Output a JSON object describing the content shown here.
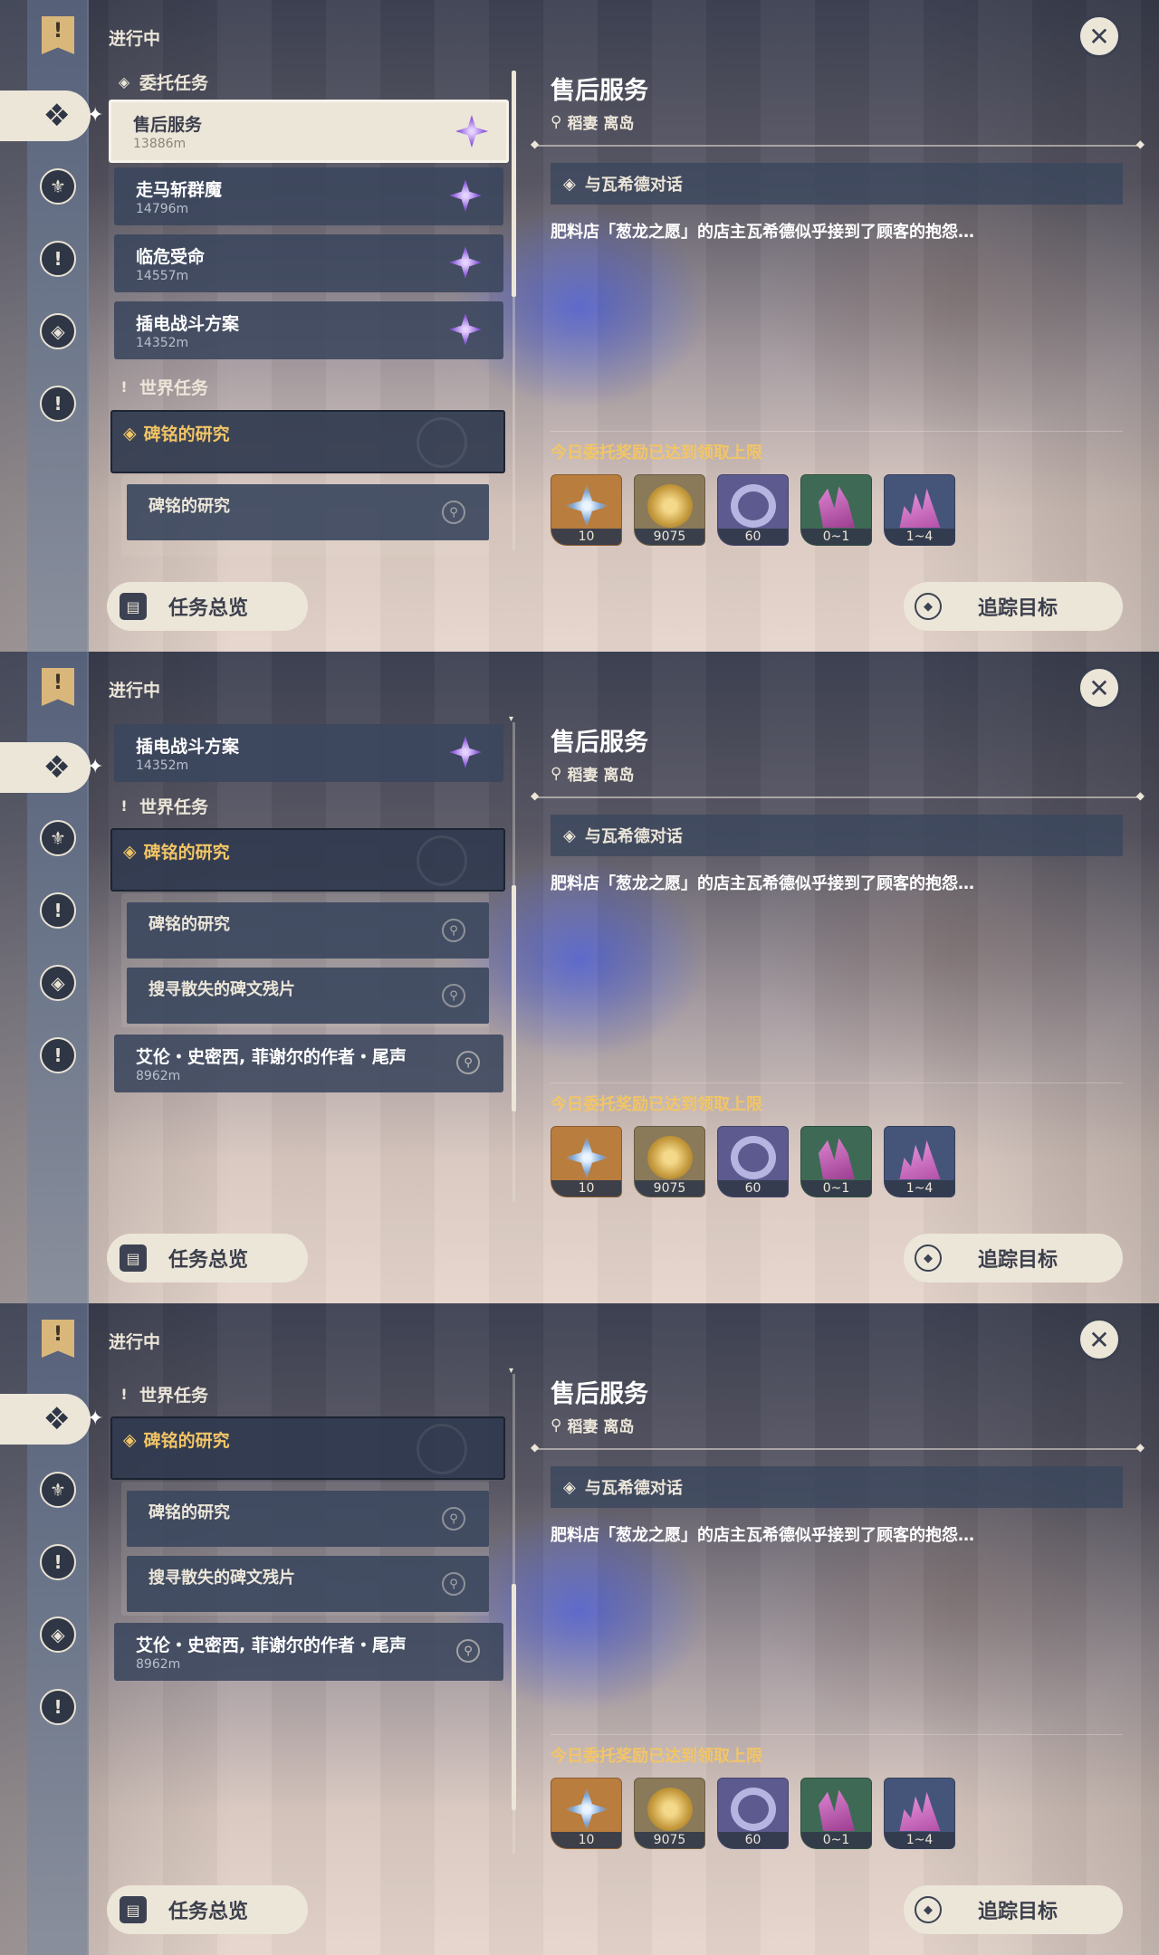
{
  "status_label": "进行中",
  "detail": {
    "title": "售后服务",
    "location": "稻妻 离岛",
    "step": "与瓦希德对话",
    "description": "肥料店「葱龙之愿」的店主瓦希德似乎接到了顾客的抱怨…",
    "reward_limit_note": "今日委托奖励已达到领取上限",
    "rewards": [
      {
        "count": "10",
        "icon": "primogem-icon",
        "color": "#b97d3e"
      },
      {
        "count": "9075",
        "icon": "mora-icon",
        "color": "#8a7a5a"
      },
      {
        "count": "60",
        "icon": "companionship-exp-icon",
        "color": "#5c5a8f"
      },
      {
        "count": "0~1",
        "icon": "enhancement-ore-icon",
        "color": "#3e6a55"
      },
      {
        "count": "1~4",
        "icon": "crystal-chunk-icon",
        "color": "#45557a"
      }
    ]
  },
  "buttons": {
    "overview": "任务总览",
    "track": "追踪目标"
  },
  "sections": {
    "commissions": "委托任务",
    "world": "世界任务"
  },
  "commissions": [
    {
      "name": "售后服务",
      "distance": "13886m"
    },
    {
      "name": "走马斩群魔",
      "distance": "14796m"
    },
    {
      "name": "临危受命",
      "distance": "14557m"
    },
    {
      "name": "插电战斗方案",
      "distance": "14352m"
    }
  ],
  "world_group": {
    "title": "碑铭的研究",
    "subtasks": [
      "碑铭的研究",
      "搜寻散失的碑文残片"
    ]
  },
  "world_quest": {
    "name": "艾伦・史密西, 菲谢尔的作者・尾声",
    "distance": "8962m"
  }
}
